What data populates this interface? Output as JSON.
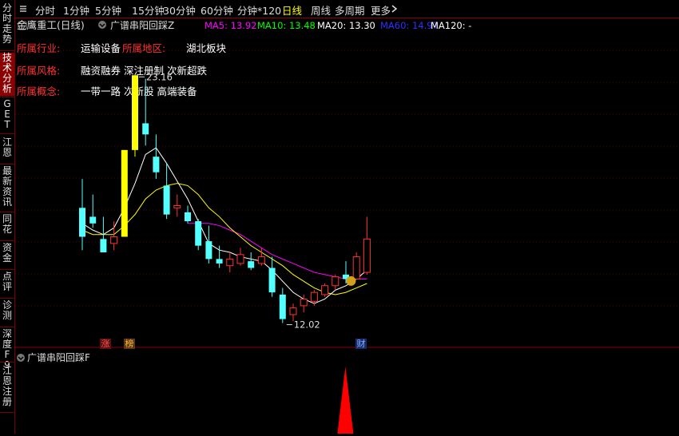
{
  "sidebar": {
    "items": [
      "分时走势",
      "技术分析",
      "GET",
      "江恩",
      "最新资讯",
      "同花",
      "资金",
      "点评",
      "诊测",
      "深度F9",
      "江恩注册"
    ]
  },
  "topbar": {
    "menu_icon": "sidebar-toggle-icon",
    "periods": [
      "分时",
      "1分钟",
      "5分钟",
      "15分钟",
      "30分钟",
      "60分钟",
      "分钟*120",
      "日线",
      "周线",
      "多周期",
      "更多"
    ],
    "active": "日线",
    "more_icon": "chevron-right-icon"
  },
  "colors": {
    "up": "#ff3232",
    "down": "#54ffff",
    "limit_up": "#ffff00",
    "ma5": "#ffffff",
    "ma10": "#ffff00",
    "ma20": "#ff00ff",
    "ma60": "#0000ff",
    "signal": "#ff0000",
    "info_label": "#ff3232",
    "border": "#8b0000"
  },
  "legend": {
    "stock": "金鹰重工(日线)",
    "indicator": "广谱串阳回踩Z",
    "ma": [
      {
        "label": "MA5: 13.92",
        "color": "#ff00ff"
      },
      {
        "label": "MA10: 13.48",
        "color": "#00ff00"
      },
      {
        "label": "MA20: 13.30",
        "color": "#ffffff"
      },
      {
        "label": "MA60: 14.97",
        "color": "#3030ff"
      },
      {
        "label": "MA120: -",
        "color": "#ffffff"
      }
    ]
  },
  "info": [
    {
      "label": "所属行业:",
      "value": "运输设备"
    },
    {
      "label": "所属地区:",
      "value": "湖北板块"
    },
    {
      "label": "所属风格:",
      "value": "融资融券 深注册制 次新超跌"
    },
    {
      "label": "所属概念:",
      "value": "一带一路 次新股 高端装备"
    }
  ],
  "annotations": {
    "high": "23.16",
    "low": "12.02"
  },
  "markers": [
    {
      "text": "涨",
      "index": 4,
      "kind": "up"
    },
    {
      "text": "榜",
      "index": 5,
      "kind": "rank"
    },
    {
      "text": "财",
      "index": 16,
      "kind": "fin"
    }
  ],
  "sub_indicator": {
    "title": "广谱串阳回踩F"
  },
  "chart_data": {
    "type": "candlestick",
    "price_range": [
      11.0,
      25.0
    ],
    "candles": [
      {
        "o": 17.2,
        "h": 18.5,
        "l": 15.3,
        "c": 15.9
      },
      {
        "o": 16.8,
        "h": 17.8,
        "l": 16.3,
        "c": 16.5
      },
      {
        "o": 15.8,
        "h": 16.8,
        "l": 15.2,
        "c": 15.2
      },
      {
        "o": 15.6,
        "h": 16.6,
        "l": 15.3,
        "c": 15.9
      },
      {
        "o": 15.9,
        "h": 19.8,
        "l": 15.9,
        "c": 19.8
      },
      {
        "o": 19.8,
        "h": 23.16,
        "l": 19.5,
        "c": 23.16
      },
      {
        "o": 21.0,
        "h": 23.0,
        "l": 20.0,
        "c": 20.5
      },
      {
        "o": 19.5,
        "h": 20.5,
        "l": 18.5,
        "c": 18.8
      },
      {
        "o": 18.2,
        "h": 19.2,
        "l": 16.7,
        "c": 16.9
      },
      {
        "o": 17.2,
        "h": 17.8,
        "l": 16.8,
        "c": 17.3
      },
      {
        "o": 17.0,
        "h": 17.3,
        "l": 16.5,
        "c": 16.6
      },
      {
        "o": 16.6,
        "h": 16.7,
        "l": 15.3,
        "c": 15.5
      },
      {
        "o": 15.7,
        "h": 16.4,
        "l": 14.7,
        "c": 14.9
      },
      {
        "o": 14.9,
        "h": 15.5,
        "l": 14.5,
        "c": 14.7
      },
      {
        "o": 14.6,
        "h": 15.2,
        "l": 14.3,
        "c": 14.9
      },
      {
        "o": 14.7,
        "h": 15.4,
        "l": 14.6,
        "c": 15.1
      },
      {
        "o": 14.8,
        "h": 15.2,
        "l": 14.4,
        "c": 14.5
      },
      {
        "o": 14.7,
        "h": 15.4,
        "l": 14.6,
        "c": 15.0
      },
      {
        "o": 14.5,
        "h": 15.0,
        "l": 13.2,
        "c": 13.4
      },
      {
        "o": 13.3,
        "h": 13.6,
        "l": 12.02,
        "c": 12.2
      },
      {
        "o": 12.4,
        "h": 12.9,
        "l": 12.1,
        "c": 12.7
      },
      {
        "o": 12.8,
        "h": 13.3,
        "l": 12.5,
        "c": 13.1
      },
      {
        "o": 13.0,
        "h": 13.5,
        "l": 12.8,
        "c": 13.4
      },
      {
        "o": 13.3,
        "h": 13.8,
        "l": 13.2,
        "c": 13.7
      },
      {
        "o": 13.7,
        "h": 14.2,
        "l": 13.5,
        "c": 14.1
      },
      {
        "o": 14.2,
        "h": 14.8,
        "l": 13.8,
        "c": 14.0
      },
      {
        "o": 14.0,
        "h": 15.2,
        "l": 14.0,
        "c": 15.0
      },
      {
        "o": 14.3,
        "h": 16.8,
        "l": 14.2,
        "c": 15.8
      }
    ],
    "ma5": [
      16.5,
      16.2,
      16.0,
      16.3,
      17.2,
      18.3,
      19.6,
      19.9,
      19.2,
      18.4,
      17.6,
      16.6,
      15.6,
      15.3,
      15.2,
      15.0,
      14.9,
      14.8,
      14.4,
      13.9,
      13.4,
      13.1,
      12.9,
      13.1,
      13.5,
      13.7,
      14.0,
      14.4
    ],
    "ma10": [
      16.2,
      16.0,
      16.0,
      16.0,
      16.4,
      16.9,
      17.6,
      18.0,
      18.2,
      18.3,
      18.2,
      17.8,
      17.2,
      16.8,
      16.3,
      15.9,
      15.5,
      15.2,
      14.9,
      14.6,
      14.2,
      13.9,
      13.6,
      13.4,
      13.3,
      13.4,
      13.6,
      13.8
    ],
    "ma20": [
      null,
      null,
      null,
      null,
      null,
      null,
      null,
      null,
      null,
      null,
      16.5,
      16.5,
      16.5,
      16.4,
      16.2,
      16.0,
      15.7,
      15.4,
      15.1,
      14.9,
      14.7,
      14.5,
      14.3,
      14.2,
      14.1,
      14.0,
      14.0,
      14.0
    ],
    "signal": {
      "index": 27,
      "value": 1
    },
    "overlay": {
      "price": "15.8"
    }
  }
}
